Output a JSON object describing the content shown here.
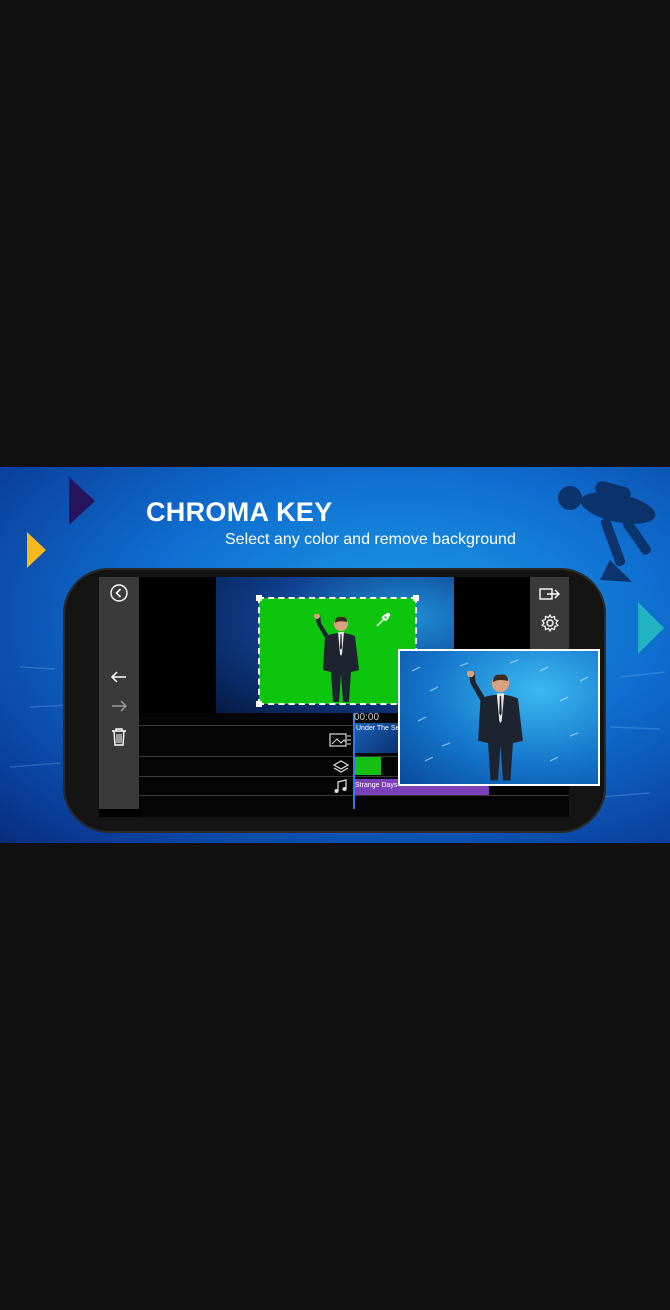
{
  "banner": {
    "headline": "CHROMA KEY",
    "subline": "Select any color and remove background"
  },
  "app": {
    "timeline": {
      "timecode": "00:00",
      "video_clip_label": "Under The Se",
      "audio_clip_label": "Strange Days"
    },
    "icons": {
      "back": "back-circle-icon",
      "undo": "undo-icon",
      "redo": "redo-icon",
      "delete": "trash-icon",
      "export": "export-icon",
      "settings": "gear-icon",
      "eyedropper": "eyedropper-icon",
      "media_track": "media-track-icon",
      "layer_track": "layer-track-icon",
      "audio_track": "music-note-icon"
    }
  },
  "colors": {
    "background": "#111111",
    "chroma_green": "#0cc50c",
    "accent_navy": "#26135c",
    "accent_yellow": "#f6b81a",
    "accent_teal": "#22b3c2",
    "audio_clip": "#7b3fb8"
  }
}
